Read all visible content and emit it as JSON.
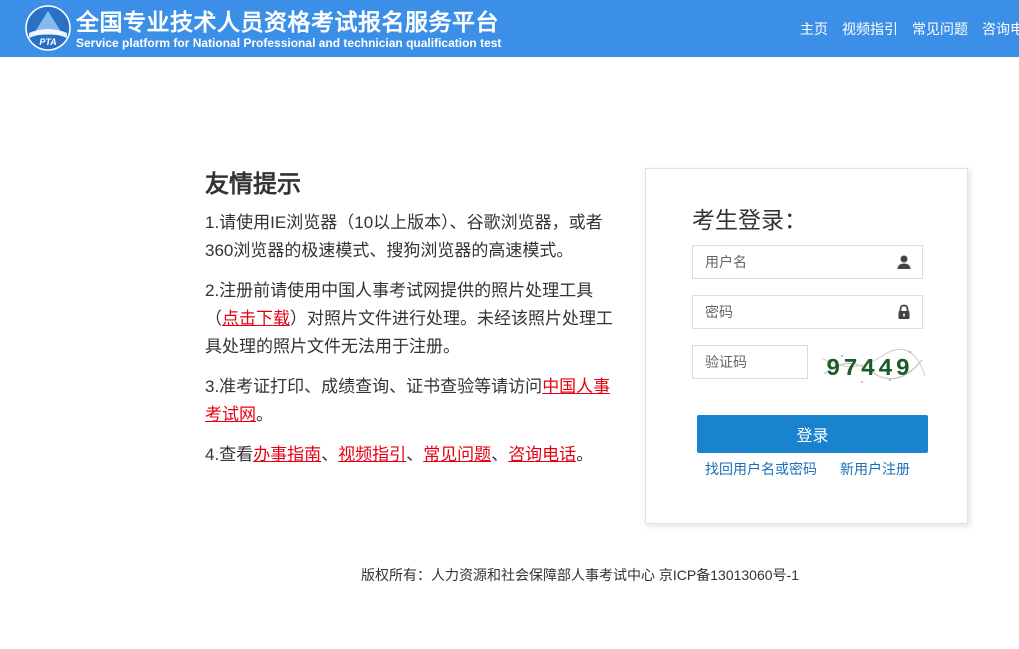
{
  "header": {
    "title": "全国专业技术人员资格考试报名服务平台",
    "subtitle": "Service platform for National Professional and technician qualification test",
    "logo_text": "PTA",
    "nav": [
      "主页",
      "视频指引",
      "常见问题",
      "咨询电话"
    ]
  },
  "tips": {
    "title": "友情提示",
    "t1": "1.请使用IE浏览器（10以上版本）、谷歌浏览器，或者360浏览器的极速模式、搜狗浏览器的高速模式。",
    "t2_pre": "2.注册前请使用中国人事考试网提供的照片处理工具（",
    "t2_link": "点击下载",
    "t2_post": "）对照片文件进行处理。未经该照片处理工具处理的照片文件无法用于注册。",
    "t3_pre": "3.准考证打印、成绩查询、证书查验等请访问",
    "t3_link": "中国人事考试网",
    "t3_post": "。",
    "t4_pre": "4.查看",
    "t4_links": [
      "办事指南",
      "视频指引",
      "常见问题",
      "咨询电话"
    ],
    "t4_sep": "、",
    "t4_post": "。"
  },
  "login": {
    "title": "考生登录：",
    "username_placeholder": "用户名",
    "password_placeholder": "密码",
    "captcha_placeholder": "验证码",
    "captcha_text": "97449",
    "submit": "登录",
    "forgot": "找回用户名或密码",
    "register": "新用户注册"
  },
  "footer": {
    "text": "版权所有：人力资源和社会保障部人事考试中心 京ICP备13013060号-1"
  },
  "colors": {
    "header_bg": "#3b8fe6",
    "button_bg": "#1a83cf",
    "link_red": "#e60012",
    "link_blue": "#1a6fb8"
  }
}
